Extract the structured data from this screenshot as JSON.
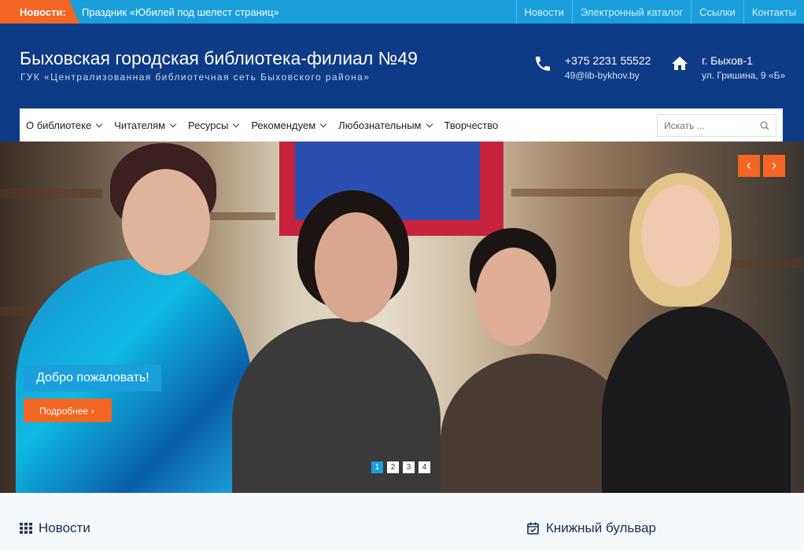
{
  "topbar": {
    "news_label": "Новости:",
    "ticker_text": "Праздник «Юбилей под шелест страниц»",
    "links": [
      "Новости",
      "Электронный каталог",
      "Ссылки",
      "Контакты"
    ]
  },
  "header": {
    "title": "Быховская городская библиотека-филиал №49",
    "subtitle": "ГУК «Централизованная библиотечная сеть Быховского района»",
    "phone": "+375 2231 55522",
    "email": "49@lib-bykhov.by",
    "city": "г. Быхов-1",
    "address": "ул. Гришина, 9 «Б»"
  },
  "nav": {
    "items": [
      {
        "label": "О библиотеке",
        "dropdown": true
      },
      {
        "label": "Читателям",
        "dropdown": true
      },
      {
        "label": "Ресурсы",
        "dropdown": true
      },
      {
        "label": "Рекомендуем",
        "dropdown": true
      },
      {
        "label": "Любознательным",
        "dropdown": true
      },
      {
        "label": "Творчество",
        "dropdown": false
      }
    ],
    "search_placeholder": "Искать ..."
  },
  "slider": {
    "caption": "Добро пожаловать!",
    "button_label": "Подробнее ›",
    "prev": "‹",
    "next": "›",
    "pages": [
      "1",
      "2",
      "3",
      "4"
    ],
    "active_page": 1
  },
  "sections": {
    "news_title": "Новости",
    "boulevard_title": "Книжный бульвар"
  },
  "colors": {
    "accent_blue": "#1a9fdb",
    "header_blue": "#0d3b85",
    "accent_orange": "#f26522"
  }
}
